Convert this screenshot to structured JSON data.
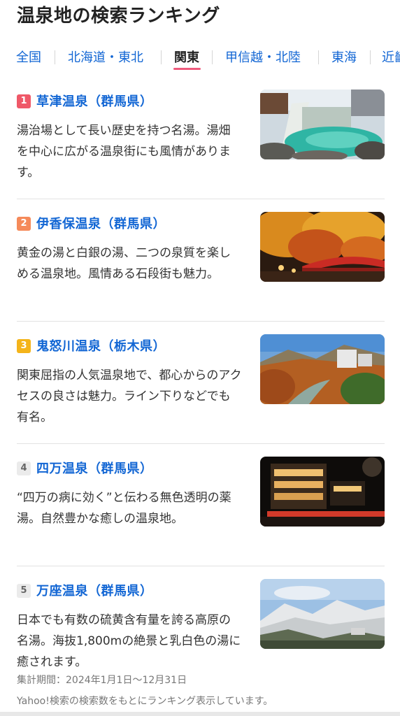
{
  "page": {
    "title": "温泉地の検索ランキング"
  },
  "tabs": [
    {
      "label": "全国",
      "active": false
    },
    {
      "label": "北海道・東北",
      "active": false
    },
    {
      "label": "関東",
      "active": true
    },
    {
      "label": "甲信越・北陸",
      "active": false
    },
    {
      "label": "東海",
      "active": false
    },
    {
      "label": "近畿",
      "active": false
    }
  ],
  "colors": {
    "link": "#1266d4",
    "active_underline": "#ee5a7c",
    "rank1": "#ef5868",
    "rank2": "#f58a5a",
    "rank3": "#f4b41a",
    "rank_other": "#ebebeb"
  },
  "rankings": [
    {
      "rank": "1",
      "name": "草津温泉（群馬県）",
      "description": "湯治場として長い歴史を持つ名湯。湯畑を中心に広がる温泉街にも風情があります。",
      "image": "yubatake-hot-spring-photo"
    },
    {
      "rank": "2",
      "name": "伊香保温泉（群馬県）",
      "description": "黄金の湯と白銀の湯、二つの泉質を楽しめる温泉地。風情ある石段街も魅力。",
      "image": "autumn-bridge-night-photo"
    },
    {
      "rank": "3",
      "name": "鬼怒川温泉（栃木県）",
      "description": "関東屈指の人気温泉地で、都心からのアクセスの良さは魅力。ライン下りなどでも有名。",
      "image": "river-valley-hotels-photo"
    },
    {
      "rank": "4",
      "name": "四万温泉（群馬県）",
      "description": "“四万の病に効く”と伝わる無色透明の薬湯。自然豊かな癒しの温泉地。",
      "image": "ryokan-night-bridge-photo"
    },
    {
      "rank": "5",
      "name": "万座温泉（群馬県）",
      "description": "日本でも有数の硫黄含有量を誇る高原の名湯。海抜1,800mの絶景と乳白色の湯に癒されます。",
      "image": "snowy-mountain-photo"
    }
  ],
  "footer": {
    "period": "集計期間：2024年1月1日〜12月31日",
    "note": "Yahoo!検索の検索数をもとにランキング表示しています。"
  }
}
